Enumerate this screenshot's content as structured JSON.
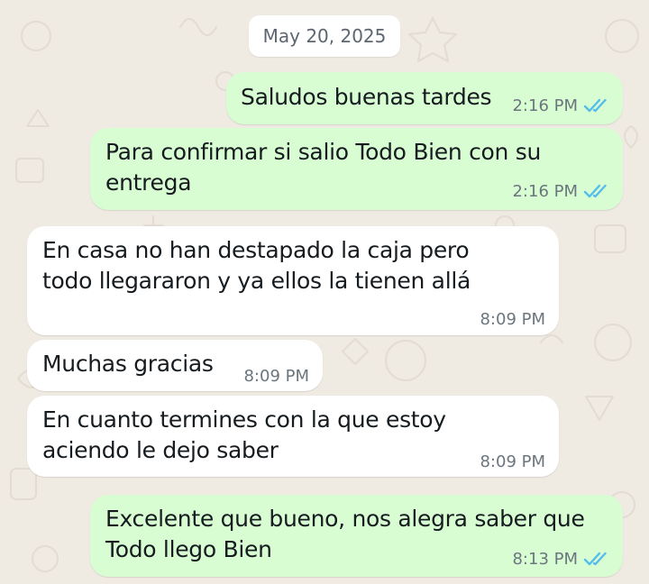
{
  "conversation": {
    "date_separator": "May 20, 2025",
    "colors": {
      "background": "#efeae2",
      "outgoing_bubble": "#d9fdd3",
      "incoming_bubble": "#ffffff",
      "read_ticks": "#53bdeb"
    },
    "messages": [
      {
        "direction": "outgoing",
        "lines": [
          "Saludos buenas tardes"
        ],
        "time": "2:16 PM",
        "status_icon": "double-check-read-icon"
      },
      {
        "direction": "outgoing",
        "lines": [
          "Para confirmar si salio Todo Bien con su",
          "entrega"
        ],
        "time": "2:16 PM",
        "status_icon": "double-check-read-icon"
      },
      {
        "direction": "incoming",
        "lines": [
          "En casa no han destapado la caja pero",
          "todo llegararon y ya ellos la tienen allá"
        ],
        "time": "8:09 PM"
      },
      {
        "direction": "incoming",
        "lines": [
          "Muchas gracias"
        ],
        "time": "8:09 PM"
      },
      {
        "direction": "incoming",
        "lines": [
          "En cuanto termines con la que estoy",
          "aciendo le dejo saber"
        ],
        "time": "8:09 PM"
      },
      {
        "direction": "outgoing",
        "lines": [
          "Excelente que bueno, nos alegra saber que",
          "Todo llego Bien"
        ],
        "time": "8:13 PM",
        "status_icon": "double-check-read-icon"
      }
    ]
  }
}
